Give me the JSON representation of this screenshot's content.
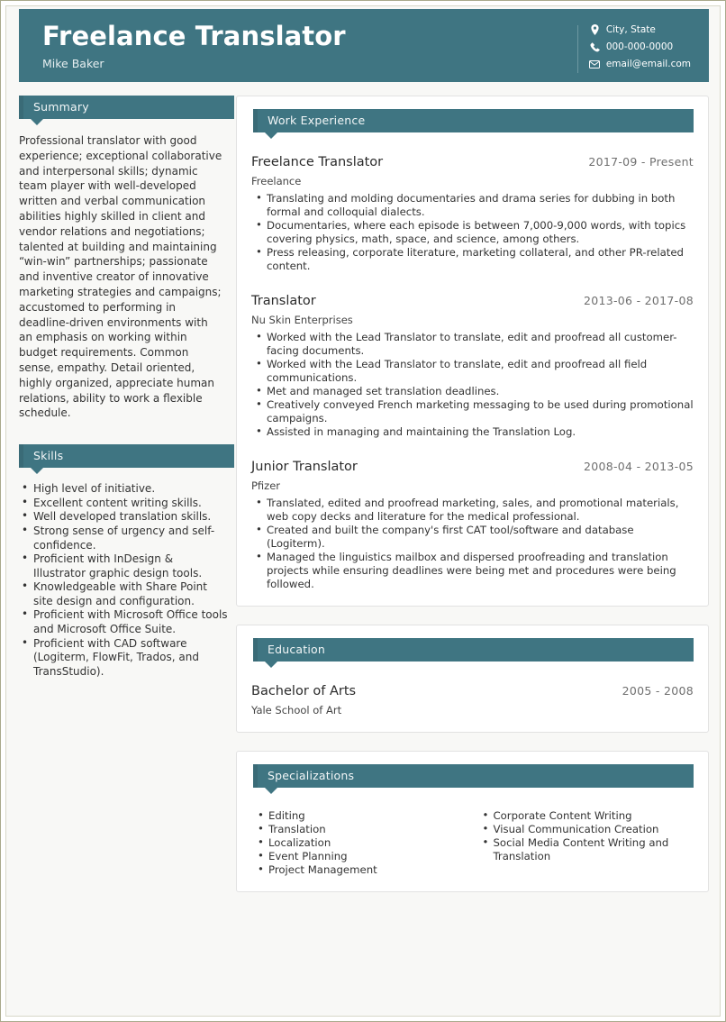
{
  "header": {
    "title": "Freelance Translator",
    "name": "Mike Baker",
    "contacts": [
      {
        "icon": "location-pin-icon",
        "text": "City, State"
      },
      {
        "icon": "phone-icon",
        "text": "000-000-0000"
      },
      {
        "icon": "envelope-icon",
        "text": "email@email.com"
      }
    ]
  },
  "theme": {
    "accent": "#3f7582",
    "accent_dark": "#3a6b77",
    "page_border": "#a9a98c",
    "text": "#333333",
    "date_text": "#6f6f6f"
  },
  "sidebar": {
    "summary": {
      "heading": "Summary",
      "text": "Professional translator with good experience; exceptional collaborative and interpersonal skills; dynamic team player with well-developed written and verbal communication abilities highly skilled in client and vendor relations and negotiations; talented at building and maintaining “win-win” partnerships; passionate and inventive creator of innovative marketing strategies and campaigns; accustomed to performing in deadline-driven environments with an emphasis on working within budget requirements. Common sense, empathy. Detail oriented, highly organized, appreciate human relations, ability to work a flexible schedule."
    },
    "skills": {
      "heading": "Skills",
      "items": [
        "High level of initiative.",
        "Excellent content writing skills.",
        "Well developed translation skills.",
        "Strong sense of urgency and self-confidence.",
        "Proficient with InDesign & Illustrator graphic design tools.",
        "Knowledgeable with Share Point site design and configuration.",
        "Proficient with Microsoft Office tools and Microsoft Office Suite.",
        "Proficient with CAD software (Logiterm, FlowFit, Trados, and TransStudio)."
      ]
    }
  },
  "main": {
    "work_experience": {
      "heading": "Work Experience",
      "entries": [
        {
          "title": "Freelance Translator",
          "date": "2017-09 - Present",
          "org": "Freelance",
          "bullets": [
            "Translating and molding documentaries and drama series for dubbing in both formal and colloquial dialects.",
            "Documentaries, where each episode is between 7,000-9,000 words, with topics covering physics, math, space, and science, among others.",
            "Press releasing, corporate literature, marketing collateral, and other PR-related content."
          ]
        },
        {
          "title": "Translator",
          "date": "2013-06 - 2017-08",
          "org": "Nu Skin Enterprises",
          "bullets": [
            "Worked with the Lead Translator to translate, edit and proofread all customer-facing documents.",
            "Worked with the Lead Translator to translate, edit and proofread all field communications.",
            "Met and managed set translation deadlines.",
            "Creatively conveyed French marketing messaging to be used during promotional campaigns.",
            "Assisted in managing and maintaining the Translation Log."
          ]
        },
        {
          "title": "Junior Translator",
          "date": "2008-04 - 2013-05",
          "org": "Pfizer",
          "bullets": [
            "Translated, edited and proofread marketing, sales, and promotional materials, web copy decks and literature for the medical professional.",
            "Created and built the company's first CAT tool/software and database (Logiterm).",
            "Managed the linguistics mailbox and dispersed proofreading and translation projects while ensuring deadlines were being met and procedures were being followed."
          ]
        }
      ]
    },
    "education": {
      "heading": "Education",
      "entries": [
        {
          "title": "Bachelor of Arts",
          "date": "2005 - 2008",
          "org": "Yale School of Art"
        }
      ]
    },
    "specializations": {
      "heading": "Specializations",
      "column_left": [
        "Editing",
        "Translation",
        "Localization",
        "Event Planning",
        "Project Management"
      ],
      "column_right": [
        "Corporate Content Writing",
        "Visual Communication Creation",
        "Social Media Content Writing and Translation"
      ]
    }
  }
}
